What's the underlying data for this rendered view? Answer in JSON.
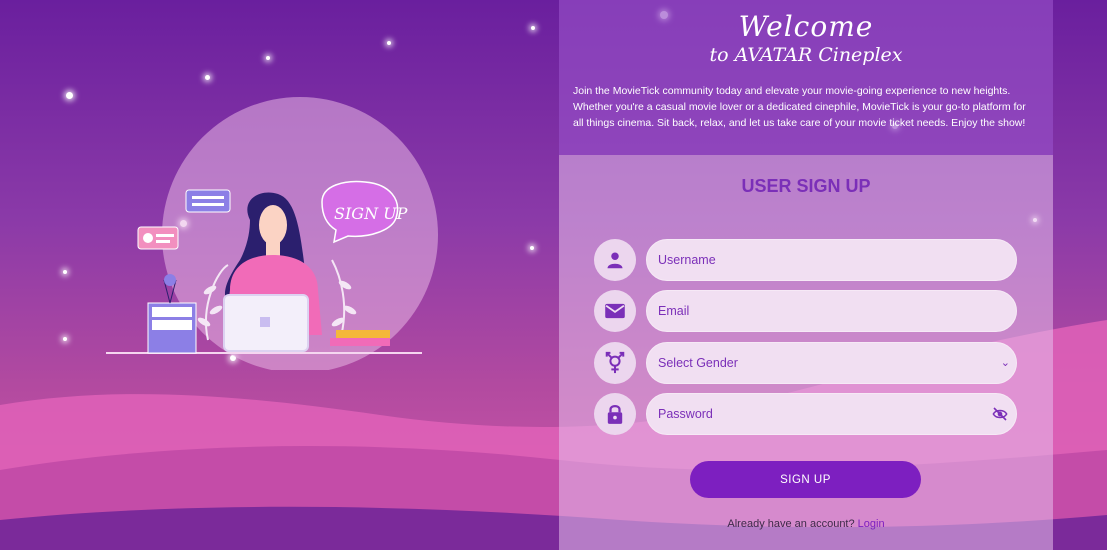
{
  "welcome": {
    "title": "Welcome",
    "subtitle": "to AVATAR Cineplex",
    "intro": "Join the MovieTick community today and elevate your movie-going experience to new heights. Whether you're a casual movie lover or a dedicated cinephile, MovieTick is your go-to platform for all things cinema. Sit back, relax, and let us take care of your movie ticket needs. Enjoy the show!"
  },
  "form": {
    "title": "USER SIGN UP",
    "username_placeholder": "Username",
    "email_placeholder": "Email",
    "gender_selected": "Select Gender",
    "password_placeholder": "Password",
    "submit_label": "SIGN UP",
    "already_text": "Already have an account?",
    "login_link": "Login"
  },
  "illustration": {
    "speech_text": "SIGN UP"
  },
  "colors": {
    "accent": "#7d1fc0",
    "field_bg": "#f1dff2",
    "panel_top": "#9650c8"
  },
  "icons": [
    "user-icon",
    "mail-icon",
    "gender-icon",
    "lock-icon",
    "eye-off-icon",
    "chevron-down-icon"
  ]
}
